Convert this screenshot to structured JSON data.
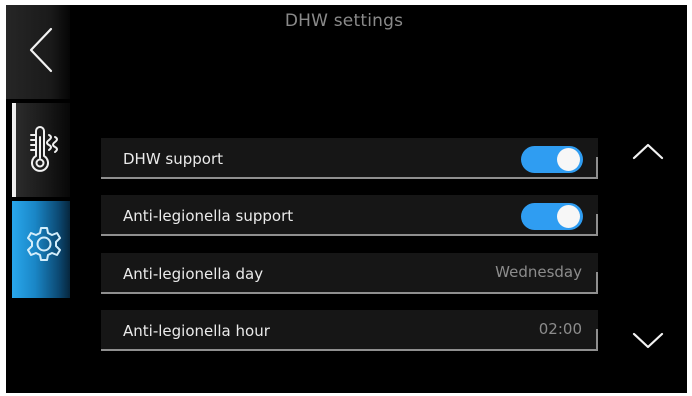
{
  "header": {
    "title": "DHW settings"
  },
  "nav": {
    "back_icon": "chevron-left-icon",
    "tabs": [
      {
        "icon": "thermometer-heat-icon",
        "active": false
      },
      {
        "icon": "gear-icon",
        "active": true
      }
    ]
  },
  "settings": [
    {
      "label": "DHW support",
      "type": "toggle",
      "on": true
    },
    {
      "label": "Anti-legionella support",
      "type": "toggle",
      "on": true
    },
    {
      "label": "Anti-legionella day",
      "type": "value",
      "value": "Wednesday"
    },
    {
      "label": "Anti-legionella hour",
      "type": "value",
      "value": "02:00"
    }
  ],
  "scroll": {
    "up_icon": "chevron-up-icon",
    "down_icon": "chevron-down-icon"
  },
  "colors": {
    "background": "#000000",
    "accent": "#2f9df2",
    "active_tab": "#1a86c6",
    "title_text": "#8a8a8a",
    "row_text": "#eaeaea",
    "value_text": "#8c8c8c",
    "row_background": "#161616",
    "row_border": "#8f8f8f"
  }
}
